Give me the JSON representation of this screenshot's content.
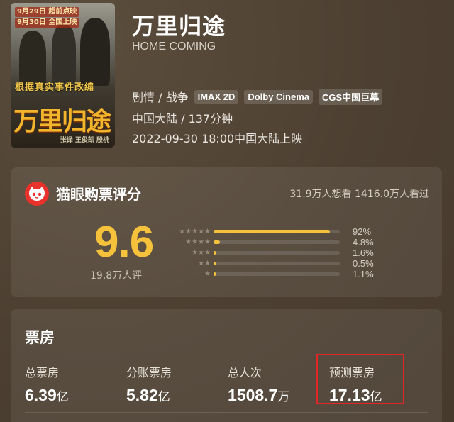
{
  "movie": {
    "title": "万里归途",
    "english_title": "HOME COMING",
    "genre": "剧情 / 战争",
    "formats": [
      "IMAX 2D",
      "Dolby Cinema",
      "CGS中国巨幕"
    ],
    "region_duration": "中国大陆 / 137分钟",
    "release": "2022-09-30 18:00中国大陆上映"
  },
  "poster": {
    "preview_line1": "9月29日 超前点映",
    "preview_line2": "9月30日 全国上映",
    "subtitle": "根据真实事件改编",
    "logo_text": "万里归途",
    "credits": "张译 王俊凯 殷桃"
  },
  "rating": {
    "title": "猫眼购票评分",
    "want_watch": "31.9万人想看 1416.0万人看过",
    "score": "9.6",
    "count": "19.8万人评",
    "distribution": [
      {
        "stars": "★★★★★",
        "percent": "92%",
        "value": 92
      },
      {
        "stars": "★★★★",
        "percent": "4.8%",
        "value": 4.8
      },
      {
        "stars": "★★★",
        "percent": "1.6%",
        "value": 1.6
      },
      {
        "stars": "★★",
        "percent": "0.5%",
        "value": 0.5
      },
      {
        "stars": "★",
        "percent": "1.1%",
        "value": 1.1
      }
    ],
    "accent_color": "#f6c23b",
    "logo_color": "#e8322b",
    "logo_icon": "cat-face-icon"
  },
  "box_office": {
    "title": "票房",
    "stats": [
      {
        "label": "总票房",
        "value": "6.39",
        "unit": "亿"
      },
      {
        "label": "分账票房",
        "value": "5.82",
        "unit": "亿"
      },
      {
        "label": "总人次",
        "value": "1508.7",
        "unit": "万"
      },
      {
        "label": "预测票房",
        "value": "17.13",
        "unit": "亿"
      }
    ],
    "highlight_color": "#e22626"
  }
}
